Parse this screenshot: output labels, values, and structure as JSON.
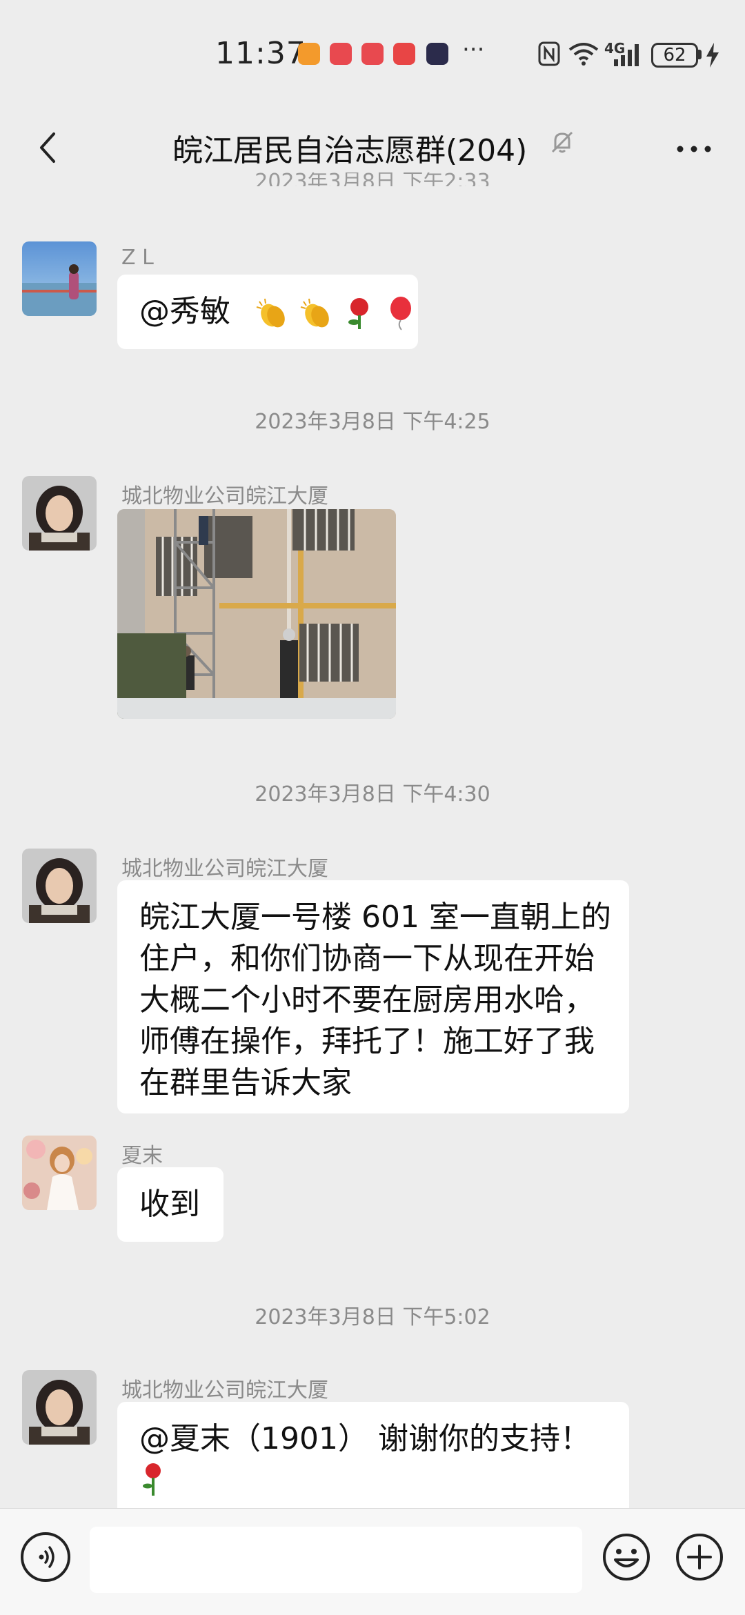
{
  "status_bar": {
    "time": "11:37",
    "network": "4G",
    "battery": "62"
  },
  "header": {
    "title": "皖江居民自治志愿群(204)"
  },
  "messages": [
    {
      "sender": "Z L",
      "text": "@秀敏"
    },
    {
      "timestamp": "2023年3月8日 下午4:25"
    },
    {
      "sender": "城北物业公司皖江大厦",
      "type": "image"
    },
    {
      "timestamp": "2023年3月8日 下午4:30"
    },
    {
      "sender": "城北物业公司皖江大厦",
      "lines": [
        "皖江大厦一号楼 601 室一直朝上的",
        "住户，和你们协商一下从现在开始",
        "大概二个小时不要在厨房用水哈，",
        "师傅在操作，拜托了！施工好了我",
        "在群里告诉大家"
      ]
    },
    {
      "sender": "夏末",
      "text": "收到"
    },
    {
      "timestamp": "2023年3月8日 下午5:02"
    },
    {
      "sender": "城北物业公司皖江大厦",
      "text": "@夏末（1901） 谢谢你的支持！"
    }
  ],
  "partial_timestamp": "2023年3月8日 下午2:33",
  "input": {
    "placeholder": ""
  },
  "colors": {
    "background": "#ededed",
    "bubble": "#ffffff",
    "meta_text": "#8a8a8a"
  }
}
